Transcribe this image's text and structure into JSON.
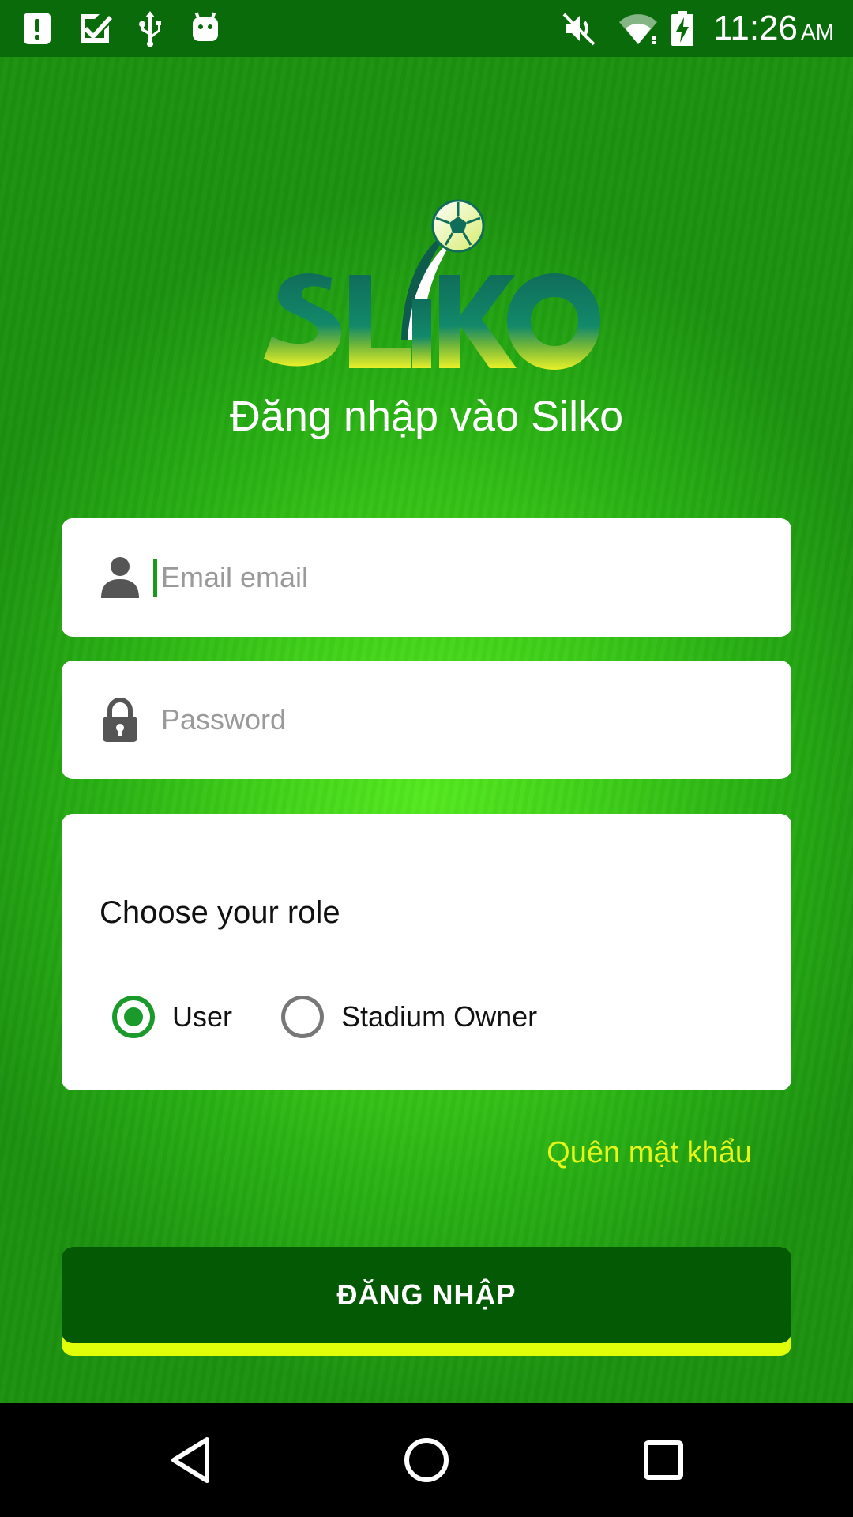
{
  "status_bar": {
    "time": "11:26",
    "ampm": "AM",
    "icons": [
      "alert-icon",
      "checkbox-notification-icon",
      "usb-icon",
      "android-debug-icon",
      "mute-icon",
      "wifi-icon",
      "battery-charging-icon"
    ]
  },
  "app": {
    "logo_text": "SLiKO",
    "title": "Đăng nhập vào Silko",
    "email": {
      "placeholder": "Email email",
      "value": ""
    },
    "password": {
      "placeholder": "Password",
      "value": ""
    },
    "role": {
      "title": "Choose your role",
      "options": [
        {
          "label": "User",
          "selected": true
        },
        {
          "label": "Stadium Owner",
          "selected": false
        }
      ]
    },
    "forgot_password": "Quên mật khẩu",
    "login_button": "ĐĂNG NHẬP"
  },
  "colors": {
    "status_bar": "#0a6b0a",
    "background_center": "#55ea1f",
    "background_edge": "#1c9110",
    "button": "#045a04",
    "button_accent": "#e2ff0a",
    "link": "#e6f51a",
    "radio_checked": "#1a9a2a"
  },
  "nav_bar": {
    "icons": [
      "back-icon",
      "home-icon",
      "recents-icon"
    ]
  }
}
